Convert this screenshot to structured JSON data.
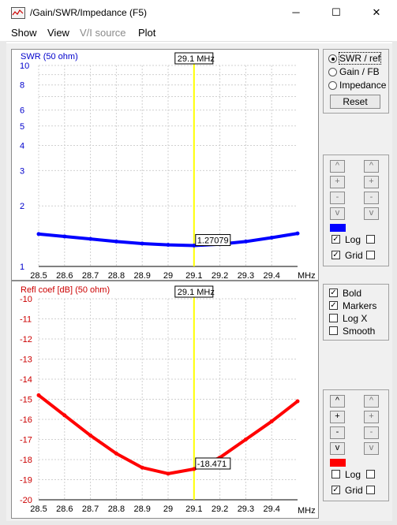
{
  "window": {
    "title": "/Gain/SWR/Impedance (F5)",
    "minimize": "─",
    "maximize": "☐",
    "close": "✕"
  },
  "menu": [
    {
      "label": "Show",
      "enabled": true
    },
    {
      "label": "View",
      "enabled": true
    },
    {
      "label": "V/I source",
      "enabled": false
    },
    {
      "label": "Plot",
      "enabled": true
    }
  ],
  "top_panel": {
    "ylabel": "SWR (50 ohm)",
    "cursor_label": "29.1 MHz",
    "marker_value": "1.27079",
    "x_unit": "MHz",
    "series_color": "#0000ff"
  },
  "bottom_panel": {
    "ylabel": "Refl coef [dB] (50 ohm)",
    "cursor_label": "29.1 MHz",
    "marker_value": "-18.471",
    "x_unit": "MHz",
    "series_color": "#ff0000"
  },
  "side": {
    "radio": [
      {
        "label": "SWR / ref",
        "checked": true
      },
      {
        "label": "Gain / FB",
        "checked": false
      },
      {
        "label": "Impedance",
        "checked": false
      }
    ],
    "reset_label": "Reset",
    "nav_buttons": [
      "^",
      "+",
      "-",
      "v"
    ],
    "top_controls": {
      "log_label": "Log",
      "log_checked": true,
      "grid_label": "Grid",
      "grid_checked": true,
      "grid2_checked": false,
      "log2_checked": false,
      "swatch_color": "#0000ff"
    },
    "mid_options": [
      {
        "label": "Bold",
        "checked": true
      },
      {
        "label": "Markers",
        "checked": true
      },
      {
        "label": "Log X",
        "checked": false
      },
      {
        "label": "Smooth",
        "checked": false
      }
    ],
    "bottom_controls": {
      "log_label": "Log",
      "log_checked": false,
      "grid_label": "Grid",
      "grid_checked": true,
      "grid2_checked": false,
      "log2_checked": false,
      "swatch_color": "#ff0000"
    }
  },
  "chart_data": [
    {
      "type": "line",
      "title": "",
      "ylabel": "SWR (50 ohm)",
      "xlabel": "MHz",
      "yscale": "log",
      "ylim": [
        1,
        10
      ],
      "xlim": [
        28.5,
        29.5
      ],
      "grid": true,
      "x_ticks": [
        "28.5",
        "28.6",
        "28.7",
        "28.8",
        "28.9",
        "29",
        "29.1",
        "29.2",
        "29.3",
        "29.4"
      ],
      "y_ticks": [
        "10",
        "8",
        "6",
        "5",
        "4",
        "3",
        "2",
        "1"
      ],
      "series": [
        {
          "x": [
            28.5,
            28.6,
            28.7,
            28.8,
            28.9,
            29.0,
            29.1,
            29.2,
            29.3,
            29.4,
            29.5
          ],
          "y": [
            1.45,
            1.41,
            1.37,
            1.33,
            1.3,
            1.28,
            1.27,
            1.29,
            1.33,
            1.39,
            1.46
          ]
        }
      ],
      "cursor_x": 29.1,
      "cursor_label": "29.1 MHz",
      "marker_label": "1.27079"
    },
    {
      "type": "line",
      "title": "",
      "ylabel": "Refl coef [dB] (50 ohm)",
      "xlabel": "MHz",
      "ylim": [
        -20,
        -10
      ],
      "xlim": [
        28.5,
        29.5
      ],
      "grid": true,
      "x_ticks": [
        "28.5",
        "28.6",
        "28.7",
        "28.8",
        "28.9",
        "29",
        "29.1",
        "29.2",
        "29.3",
        "29.4"
      ],
      "y_ticks": [
        "-10",
        "-11",
        "-12",
        "-13",
        "-14",
        "-15",
        "-16",
        "-17",
        "-18",
        "-19",
        "-20"
      ],
      "series": [
        {
          "x": [
            28.5,
            28.6,
            28.7,
            28.8,
            28.9,
            29.0,
            29.1,
            29.2,
            29.3,
            29.4,
            29.5
          ],
          "y": [
            -14.8,
            -15.8,
            -16.8,
            -17.7,
            -18.4,
            -18.7,
            -18.47,
            -17.9,
            -17.0,
            -16.1,
            -15.1
          ]
        }
      ],
      "cursor_x": 29.1,
      "cursor_label": "29.1 MHz",
      "marker_label": "-18.471"
    }
  ]
}
